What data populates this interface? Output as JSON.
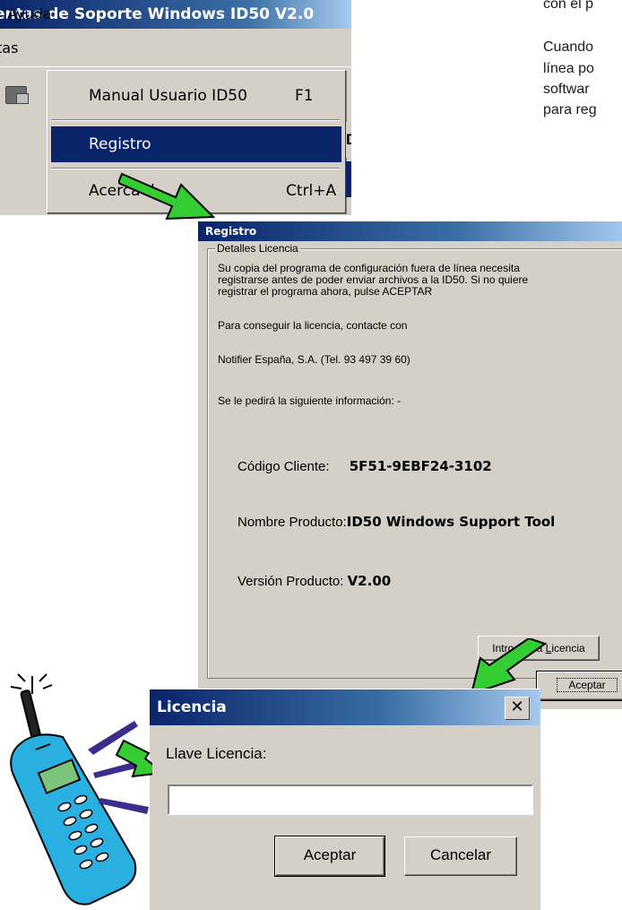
{
  "doc_text": {
    "line1": "con el p",
    "line2": "Cuando",
    "line3": "línea po",
    "line4": "softwar",
    "line5": "para reg"
  },
  "menu_screenshot": {
    "app_title": "entas de Soporte Windows ID50 V2.0",
    "menubar": {
      "item_left": "tas",
      "item_ayuda": "Ayuda"
    },
    "dropdown": {
      "manual_label": "Manual Usuario ID50",
      "manual_key": "F1",
      "registro_label": "Registro",
      "acerca_label": "Acerca d",
      "acerca_key": "Ctrl+A"
    },
    "side_letter": "D"
  },
  "registro_dialog": {
    "title": "Registro",
    "group_label": "Detalles Licencia",
    "text_line1": "Su copia del programa de configuración fuera de línea necesita",
    "text_line2": "registrarse antes de poder enviar archivos a la ID50. Si no quiere",
    "text_line3": "registrar el programa ahora, pulse ACEPTAR",
    "contact_line": "Para conseguir la licencia, contacte con",
    "company_line": "Notifier España, S.A. (Tel. 93 497 39 60)",
    "info_line": "Se le pedirá la siguiente información: -",
    "codigo_label": "Código Cliente:",
    "codigo_value": "5F51-9EBF24-3102",
    "nombre_label": "Nombre Producto:",
    "nombre_value": "ID50 Windows Support Tool",
    "version_label": "Versión Producto:",
    "version_value": "V2.00",
    "btn_introduzca_pre": "Introduzca ",
    "btn_introduzca_u": "L",
    "btn_introduzca_post": "icencia",
    "btn_aceptar": "Aceptar"
  },
  "licencia_dialog": {
    "title": "Licencia",
    "close_glyph": "✕",
    "field_label": "Llave Licencia:",
    "field_value": "",
    "btn_aceptar": "Aceptar",
    "btn_cancelar": "Cancelar"
  },
  "colors": {
    "titlebar_dark": "#0a246a",
    "titlebar_light": "#a6caf0",
    "dialog_face": "#d4d0c8",
    "arrow_green": "#33cc33",
    "phone_body": "#2ab0e0"
  },
  "icons": [
    "arrow-icon",
    "phone-icon",
    "close-icon",
    "toolbar-icon"
  ]
}
